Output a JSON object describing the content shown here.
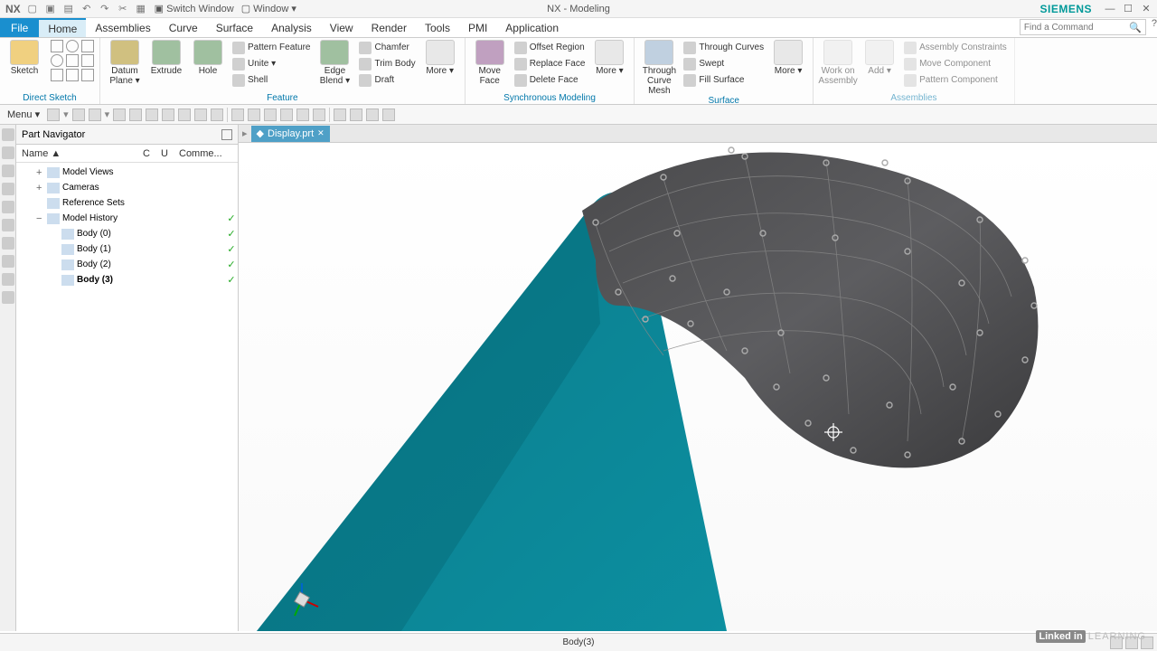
{
  "title": {
    "app": "NX",
    "doc": "NX - Modeling",
    "vendor": "SIEMENS"
  },
  "qat": {
    "switch": "Switch Window",
    "window": "Window ▾"
  },
  "search": {
    "ph": "Find a Command"
  },
  "menus": {
    "file": "File",
    "tabs": [
      "Home",
      "Assemblies",
      "Curve",
      "Surface",
      "Analysis",
      "View",
      "Render",
      "Tools",
      "PMI",
      "Application"
    ]
  },
  "ribbon": {
    "g_direct": {
      "title": "Direct Sketch",
      "sketch": "Sketch"
    },
    "g_feature": {
      "title": "Feature",
      "datum": "Datum Plane ▾",
      "extrude": "Extrude",
      "hole": "Hole",
      "pattern": "Pattern Feature",
      "unite": "Unite ▾",
      "shell": "Shell",
      "edge": "Edge Blend ▾",
      "chamfer": "Chamfer",
      "trim": "Trim Body",
      "draft": "Draft",
      "more": "More ▾"
    },
    "g_sync": {
      "title": "Synchronous Modeling",
      "move": "Move Face",
      "offset": "Offset Region",
      "replace": "Replace Face",
      "delete": "Delete Face",
      "more": "More ▾"
    },
    "g_surface": {
      "title": "Surface",
      "mesh": "Through Curve Mesh",
      "curves": "Through Curves",
      "swept": "Swept",
      "fill": "Fill Surface",
      "more": "More ▾"
    },
    "g_assy": {
      "title": "Assemblies",
      "work": "Work on Assembly",
      "add": "Add ▾",
      "con": "Assembly Constraints",
      "move": "Move Component",
      "pat": "Pattern Component"
    }
  },
  "toolbar": {
    "menu": "Menu ▾"
  },
  "nav": {
    "title": "Part Navigator",
    "cols": {
      "name": "Name  ▲",
      "c": "C",
      "u": "U",
      "comm": "Comme..."
    },
    "rows": [
      {
        "t": "Model Views",
        "l": 1,
        "exp": "+"
      },
      {
        "t": "Cameras",
        "l": 1,
        "exp": "+"
      },
      {
        "t": "Reference Sets",
        "l": 1,
        "exp": ""
      },
      {
        "t": "Model History",
        "l": 1,
        "exp": "−",
        "chk": "✓"
      },
      {
        "t": "Body (0)",
        "l": 2,
        "chk": "✓"
      },
      {
        "t": "Body (1)",
        "l": 2,
        "chk": "✓"
      },
      {
        "t": "Body (2)",
        "l": 2,
        "chk": "✓"
      },
      {
        "t": "Body (3)",
        "l": 2,
        "chk": "✓",
        "b": true
      }
    ]
  },
  "docTab": {
    "name": "Display.prt"
  },
  "status": {
    "sel": "Body(3)"
  },
  "wm": {
    "li": "Linked in",
    "learn": "LEARNING"
  }
}
